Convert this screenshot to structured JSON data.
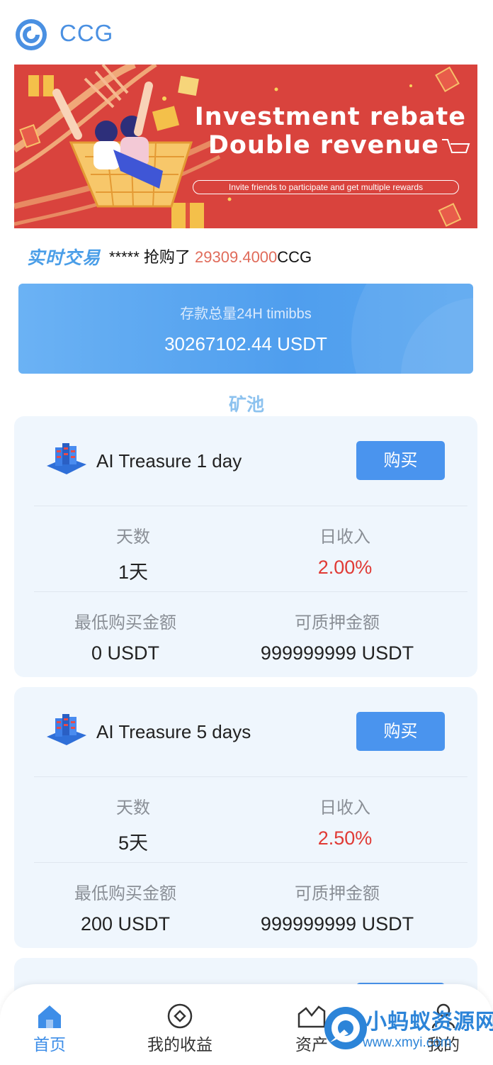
{
  "header": {
    "brand": "CCG"
  },
  "banner": {
    "headline_1": "Investment rebate",
    "headline_2": "Double revenue",
    "subline": "Invite friends to participate and get multiple rewards"
  },
  "live_trade": {
    "tag": "实时交易",
    "user": "*****",
    "action": " 抢购了 ",
    "amount": "29309.4000",
    "unit": "CCG"
  },
  "deposit": {
    "label": "存款总量24H timibbs",
    "value": "30267102.44 USDT"
  },
  "pools_title": "矿池",
  "pools": [
    {
      "name": "AI Treasure 1 day",
      "buy_label": "购买",
      "days_label": "天数",
      "days_value": "1天",
      "daily_label": "日收入",
      "daily_value": "2.00%",
      "min_label": "最低购买金额",
      "min_value": "0 USDT",
      "pledge_label": "可质押金额",
      "pledge_value": "999999999 USDT"
    },
    {
      "name": "AI Treasure 5 days",
      "buy_label": "购买",
      "days_label": "天数",
      "days_value": "5天",
      "daily_label": "日收入",
      "daily_value": "2.50%",
      "min_label": "最低购买金额",
      "min_value": "200 USDT",
      "pledge_label": "可质押金额",
      "pledge_value": "999999999 USDT"
    }
  ],
  "nav": {
    "home": "首页",
    "earnings": "我的收益",
    "assets": "资产",
    "mine": "我的"
  },
  "watermark": {
    "line1": "小蚂蚁资源网",
    "line2": "www.xmyi.com"
  },
  "colors": {
    "accent": "#4a94ee",
    "banner": "#d9433d",
    "rate": "#e03a35",
    "card_bg": "#eff6fd"
  }
}
